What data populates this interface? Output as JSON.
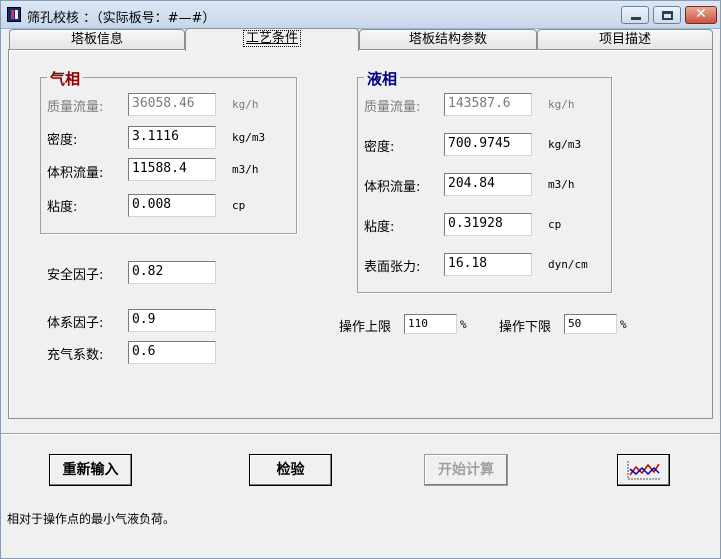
{
  "window": {
    "title": "筛孔校核 ：（实际板号：#—#）",
    "close_glyph": "✕"
  },
  "tabs": [
    {
      "label": "塔板信息"
    },
    {
      "label": "工艺条件"
    },
    {
      "label": "塔板结构参数"
    },
    {
      "label": "项目描述"
    }
  ],
  "gas": {
    "title": "气相",
    "title_color": "#8b0000",
    "rows": [
      {
        "label": "质量流量:",
        "value": "36058.46",
        "unit": "kg/h"
      },
      {
        "label": "密度:",
        "value": "3.1116",
        "unit": "kg/m3"
      },
      {
        "label": "体积流量:",
        "value": "11588.4",
        "unit": "m3/h"
      },
      {
        "label": "粘度:",
        "value": "0.008",
        "unit": "cp"
      }
    ]
  },
  "liquid": {
    "title": "液相",
    "title_color": "#00008b",
    "rows": [
      {
        "label": "质量流量:",
        "value": "143587.6",
        "unit": "kg/h"
      },
      {
        "label": "密度:",
        "value": "700.9745",
        "unit": "kg/m3"
      },
      {
        "label": "体积流量:",
        "value": "204.84",
        "unit": "m3/h"
      },
      {
        "label": "粘度:",
        "value": "0.31928",
        "unit": "cp"
      },
      {
        "label": "表面张力:",
        "value": "16.18",
        "unit": "dyn/cm"
      }
    ]
  },
  "factors": {
    "safety": {
      "label": "安全因子:",
      "value": "0.82"
    },
    "system": {
      "label": "体系因子:",
      "value": "0.9"
    },
    "aeration": {
      "label": "充气系数:",
      "value": "0.6"
    }
  },
  "limits": {
    "upper": {
      "label": "操作上限",
      "value": "110",
      "unit": "%"
    },
    "lower": {
      "label": "操作下限",
      "value": "50",
      "unit": "%"
    }
  },
  "buttons": {
    "reinput": "重新输入",
    "check": "检验",
    "start_calc": "开始计算"
  },
  "status": "相对于操作点的最小气液负荷。"
}
